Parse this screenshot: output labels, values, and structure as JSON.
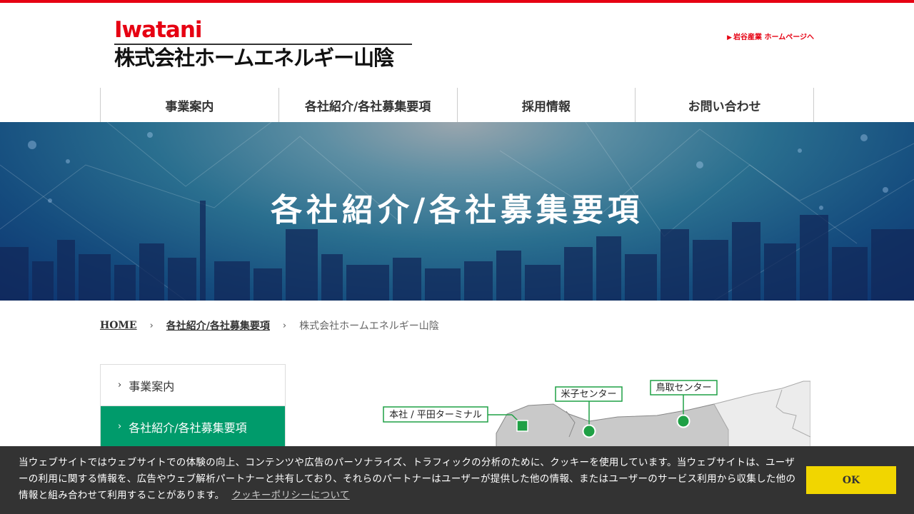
{
  "header": {
    "brand": "Iwatani",
    "company": "株式会社ホームエネルギー山陰",
    "corp_link": "岩谷産業 ホームページへ",
    "corp_link_icon": "play-triangle-icon"
  },
  "nav": {
    "items": [
      {
        "label": "事業案内"
      },
      {
        "label": "各社紹介/各社募集要項"
      },
      {
        "label": "採用情報"
      },
      {
        "label": "お問い合わせ"
      }
    ]
  },
  "hero": {
    "title": "各社紹介/各社募集要項"
  },
  "breadcrumb": {
    "home": "HOME",
    "parent": "各社紹介/各社募集要項",
    "current": "株式会社ホームエネルギー山陰"
  },
  "sidenav": {
    "items": [
      {
        "label": "事業案内",
        "active": false
      },
      {
        "label": "各社紹介/各社募集要項",
        "active": true
      }
    ]
  },
  "map": {
    "locations": [
      {
        "label": "本社 / 平田ターミナル",
        "marker": "square"
      },
      {
        "label": "米子センター",
        "marker": "circle"
      },
      {
        "label": "鳥取センター",
        "marker": "circle"
      }
    ],
    "marker_color": "#1fa045"
  },
  "cookie": {
    "message": "当ウェブサイトではウェブサイトでの体験の向上、コンテンツや広告のパーソナライズ、トラフィックの分析のために、クッキーを使用しています。当ウェブサイトは、ユーザーの利用に関する情報を、広告やウェブ解析パートナーと共有しており、それらのパートナーはユーザーが提供した他の情報、またはユーザーのサービス利用から収集した他の情報と組み合わせて利用することがあります。",
    "policy_link": "クッキーポリシーについて",
    "ok_label": "OK"
  },
  "colors": {
    "brand_red": "#e60012",
    "active_green": "#009b6b",
    "cookie_button": "#f1d600",
    "cookie_bg": "#333333"
  }
}
